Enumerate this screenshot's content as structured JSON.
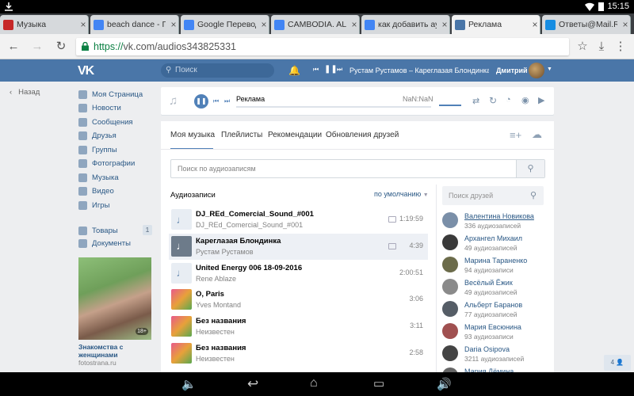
{
  "status": {
    "time": "15:15"
  },
  "browser": {
    "tabs": [
      {
        "label": "Музыка",
        "fav": "#c62828",
        "active": false
      },
      {
        "label": "beach dance - Го",
        "fav": "#4285f4",
        "active": false
      },
      {
        "label": "Google Переводч",
        "fav": "#4285f4",
        "active": false
      },
      {
        "label": "CAMBODIA. ALL",
        "fav": "#4285f4",
        "active": false
      },
      {
        "label": "как добавить ау",
        "fav": "#4285f4",
        "active": false
      },
      {
        "label": "Реклама",
        "fav": "#4a76a8",
        "active": true
      },
      {
        "label": "Ответы@Mail.Ru",
        "fav": "#168de2",
        "active": false
      }
    ],
    "url_scheme": "https://",
    "url_rest": "vk.com/audios343825331"
  },
  "vk": {
    "logo": "VK",
    "search_placeholder": "Поиск",
    "now_playing": "Рустам Рустамов – Карегла­зая Блондинка",
    "user": "Дмитрий"
  },
  "sidebar": {
    "back": "Назад",
    "items": [
      "Моя Страница",
      "Новости",
      "Сообщения",
      "Друзья",
      "Группы",
      "Фотографии",
      "Музыка",
      "Видео",
      "Игры"
    ],
    "goods": "Товары",
    "goods_count": "1",
    "docs": "Документы",
    "ad_title": "Знакомства с женщинами",
    "ad_domain": "fotostrana.ru",
    "ad_badge": "18+"
  },
  "player": {
    "title": "Реклама",
    "time": "NaN:NaN",
    "progress": 0
  },
  "main": {
    "tabs": [
      "Моя музыка",
      "Плейлисты",
      "Рекомендации",
      "Обновления друзей"
    ],
    "search_placeholder": "Поиск по аудиозаписям",
    "section": "Аудиозаписи",
    "sort": "по умолчанию",
    "tracks": [
      {
        "title": "DJ_REd_Comercial_Sound_#001",
        "artist": "DJ_REd_Comercial_Sound_#001",
        "duration": "1:19:59",
        "hq": true,
        "selected": false
      },
      {
        "title": "Кареглазая Блондинка",
        "artist": "Рустам Рустамов",
        "duration": "4:39",
        "hq": true,
        "selected": true
      },
      {
        "title": "United Energy 006 18-09-2016",
        "artist": "Rene Ablaze",
        "duration": "2:00:51",
        "hq": false,
        "selected": false
      },
      {
        "title": "O, Paris",
        "artist": "Yves Montand",
        "duration": "3:06",
        "hq": false,
        "selected": false
      },
      {
        "title": "Без названия",
        "artist": "Неизвестен",
        "duration": "3:11",
        "hq": false,
        "selected": false
      },
      {
        "title": "Без названия",
        "artist": "Неизвестен",
        "duration": "2:58",
        "hq": false,
        "selected": false
      }
    ],
    "friends_search_placeholder": "Поиск друзей",
    "friends": [
      {
        "name": "Валентина Новикова",
        "count": "336 аудиозаписей",
        "color": "#7a8fa8"
      },
      {
        "name": "Архангел Михаил",
        "count": "49 аудиозаписей",
        "color": "#3a3a3a"
      },
      {
        "name": "Марина Тараненко",
        "count": "94 аудиозаписи",
        "color": "#6b6b4a"
      },
      {
        "name": "Весёлый Ёжик",
        "count": "49 аудиозаписей",
        "color": "#8a8a8a"
      },
      {
        "name": "Альберт Баранов",
        "count": "77 аудиозаписей",
        "color": "#555d66"
      },
      {
        "name": "Мария Евсюнина",
        "count": "93 аудиозаписи",
        "color": "#a05050"
      },
      {
        "name": "Daria Osipova",
        "count": "3211 аудиозаписей",
        "color": "#444"
      },
      {
        "name": "Мария Дёмина",
        "count": "",
        "color": "#666"
      }
    ],
    "chat_count": "4"
  }
}
